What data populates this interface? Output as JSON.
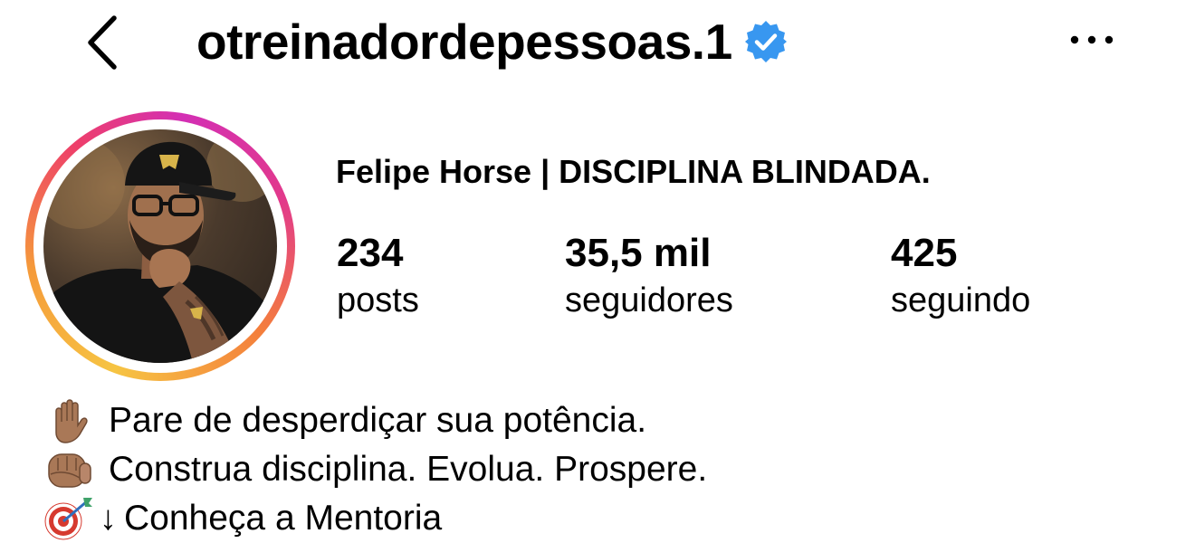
{
  "header": {
    "username": "otreinadordepessoas.1",
    "back_icon": "chevron-left-icon",
    "verified_icon": "verified-badge-icon",
    "more_icon": "more-horizontal-icon",
    "verified_color": "#3897f0"
  },
  "profile": {
    "display_name": "Felipe Horse | DISCIPLINA BLINDADA.",
    "avatar_icon": "profile-photo",
    "stats": {
      "posts": {
        "value": "234",
        "label": "posts"
      },
      "followers": {
        "value": "35,5 mil",
        "label": "seguidores"
      },
      "following": {
        "value": "425",
        "label": "seguindo"
      }
    }
  },
  "bio": {
    "lines": [
      {
        "emoji": "raised-hand-icon",
        "text": "Pare de desperdiçar sua potência."
      },
      {
        "emoji": "fist-icon",
        "text": "Construa disciplina. Evolua. Prospere."
      },
      {
        "emoji": "target-icon",
        "arrow": "↓",
        "text": "Conheça a Mentoria"
      }
    ]
  },
  "colors": {
    "text": "#000000",
    "background": "#ffffff",
    "story_ring": [
      "#f6c443",
      "#ee3f6a",
      "#d32fb4"
    ]
  }
}
